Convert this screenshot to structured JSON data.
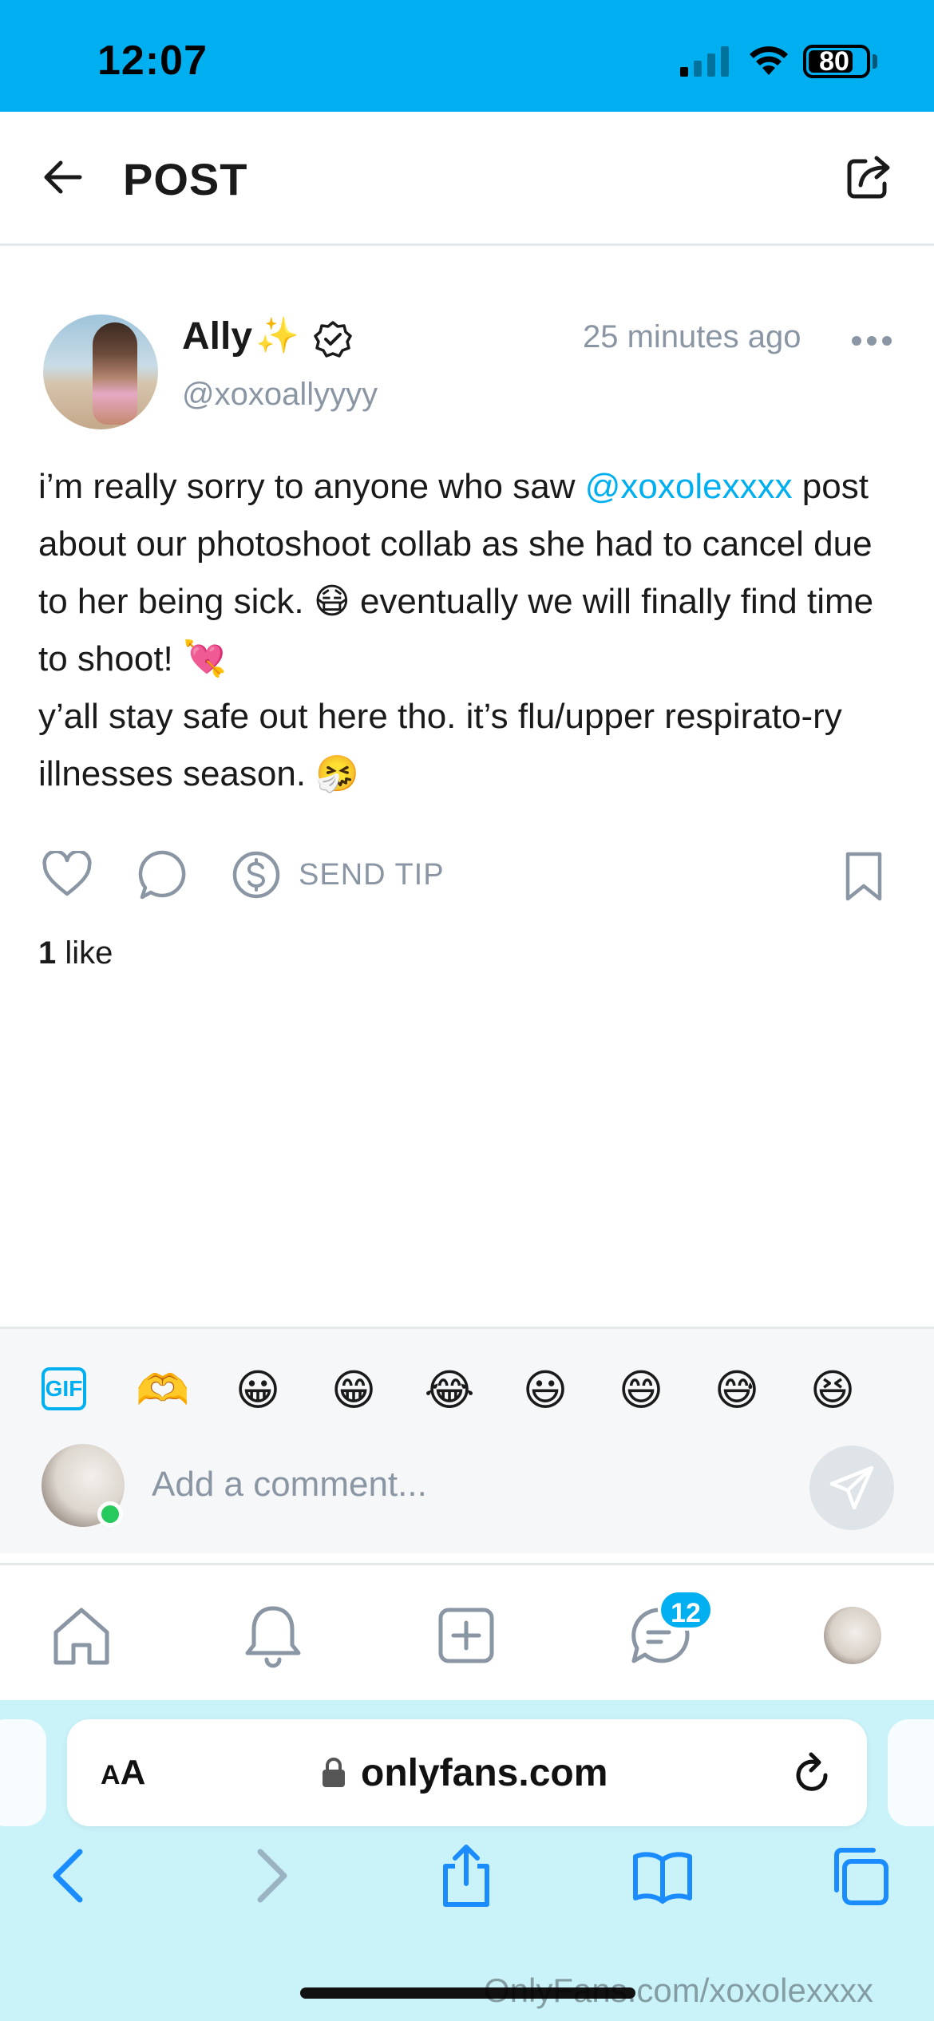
{
  "status_bar": {
    "time": "12:07",
    "battery": "80",
    "battery_level_percent": 80
  },
  "header": {
    "title": "POST"
  },
  "post": {
    "author_name": "Ally",
    "author_name_emoji": "✨",
    "author_handle": "@xoxoallyyyy",
    "time": "25 minutes ago",
    "text_part1": "i’m really sorry to anyone who saw ",
    "mention": "@xoxolexxxx",
    "text_part2": " post about our photoshoot collab as she had to cancel due to her being sick. 😷 eventually we will finally find time to shoot! 💘",
    "text_part3": "y’all stay safe out here tho. it’s flu/upper respirato-ry illnesses season. 🤧",
    "send_tip_label": "SEND TIP",
    "likes_number": "1",
    "likes_label": " like"
  },
  "comment": {
    "gif_label": "GIF",
    "emojis": [
      "🫶",
      "😀",
      "😁",
      "😂",
      "😃",
      "😄",
      "😅",
      "😆"
    ],
    "placeholder": "Add a comment..."
  },
  "bottom_nav": {
    "messages_badge": "12"
  },
  "browser": {
    "aa_label_small": "A",
    "aa_label_large": "A",
    "url": "onlyfans.com"
  },
  "watermark": "OnlyFans.com/xoxolexxxx",
  "colors": {
    "brand": "#00aff0",
    "muted": "#8a96a3",
    "online": "#26c95b"
  }
}
